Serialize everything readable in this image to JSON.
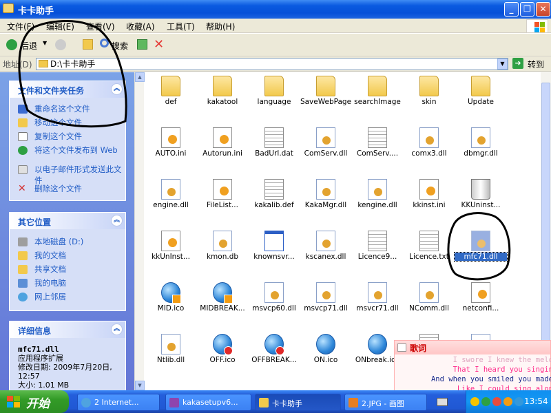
{
  "window": {
    "title": "卡卡助手",
    "min": "_",
    "max": "❐",
    "close": "✕"
  },
  "menu": [
    "文件(F)",
    "编辑(E)",
    "查看(V)",
    "收藏(A)",
    "工具(T)",
    "帮助(H)"
  ],
  "toolbar": {
    "back": "后退",
    "search": "搜索"
  },
  "address": {
    "label": "地址(D)",
    "value": "D:\\卡卡助手",
    "go": "转到"
  },
  "tasks": {
    "header": "文件和文件夹任务",
    "items": [
      "重命名这个文件",
      "移动这个文件",
      "复制这个文件",
      "将这个文件发布到 Web",
      "以电子邮件形式发送此文件",
      "删除这个文件"
    ]
  },
  "places": {
    "header": "其它位置",
    "items": [
      "本地磁盘 (D:)",
      "我的文档",
      "共享文档",
      "我的电脑",
      "网上邻居"
    ]
  },
  "details": {
    "header": "详细信息",
    "name": "mfc71.dll",
    "type": "应用程序扩展",
    "modified": "修改日期: 2009年7月20日, 12:57",
    "size": "大小: 1.01 MB"
  },
  "files": [
    {
      "name": "def",
      "kind": "folder"
    },
    {
      "name": "kakatool",
      "kind": "folder"
    },
    {
      "name": "language",
      "kind": "folder"
    },
    {
      "name": "SaveWebPage",
      "kind": "folder"
    },
    {
      "name": "searchImage",
      "kind": "folder"
    },
    {
      "name": "skin",
      "kind": "folder"
    },
    {
      "name": "Update",
      "kind": "folder"
    },
    {
      "name": "AUTO.ini",
      "kind": "ini"
    },
    {
      "name": "Autorun.ini",
      "kind": "ini"
    },
    {
      "name": "BadUrl.dat",
      "kind": "doc"
    },
    {
      "name": "ComServ.dll",
      "kind": "dll"
    },
    {
      "name": "ComServ....",
      "kind": "doc"
    },
    {
      "name": "comx3.dll",
      "kind": "dll"
    },
    {
      "name": "dbmgr.dll",
      "kind": "dll"
    },
    {
      "name": "engine.dll",
      "kind": "dll"
    },
    {
      "name": "FileList...",
      "kind": "ini"
    },
    {
      "name": "kakalib.def",
      "kind": "doc"
    },
    {
      "name": "KakaMgr.dll",
      "kind": "dll"
    },
    {
      "name": "kengine.dll",
      "kind": "dll"
    },
    {
      "name": "kkinst.ini",
      "kind": "ini"
    },
    {
      "name": "KKUninst...",
      "kind": "trash"
    },
    {
      "name": "kkUnInst...",
      "kind": "ini"
    },
    {
      "name": "kmon.db",
      "kind": "dll"
    },
    {
      "name": "knownsvr...",
      "kind": "win"
    },
    {
      "name": "kscanex.dll",
      "kind": "dll"
    },
    {
      "name": "Licence9...",
      "kind": "doc"
    },
    {
      "name": "Licence.txt",
      "kind": "doc"
    },
    {
      "name": "mfc71.dll",
      "kind": "dll",
      "selected": true
    },
    {
      "name": "MID.ico",
      "kind": "globe-pause"
    },
    {
      "name": "MIDBREAK...",
      "kind": "globe-pause"
    },
    {
      "name": "msvcp60.dll",
      "kind": "dll"
    },
    {
      "name": "msvcp71.dll",
      "kind": "dll"
    },
    {
      "name": "msvcr71.dll",
      "kind": "dll"
    },
    {
      "name": "NComm.dll",
      "kind": "dll"
    },
    {
      "name": "netconfi...",
      "kind": "ini"
    },
    {
      "name": "Ntlib.dll",
      "kind": "dll"
    },
    {
      "name": "OFF.ico",
      "kind": "globe-stop"
    },
    {
      "name": "OFFBREAK...",
      "kind": "globe-stop"
    },
    {
      "name": "ON.ico",
      "kind": "globe"
    },
    {
      "name": "ONbreak.ico",
      "kind": "globe"
    },
    {
      "name": "",
      "kind": "doc"
    },
    {
      "name": "",
      "kind": "dll"
    }
  ],
  "lyrics": {
    "title": "歌词",
    "lines": [
      "I swore I knew the melo",
      "That I heard you singin",
      "And when you smiled you made",
      "Like I could sing alon"
    ]
  },
  "taskbar": {
    "start": "开始",
    "tasks": [
      "2 Internet...",
      "kakasetupv6...",
      "卡卡助手",
      "2.JPG - 画图"
    ],
    "clock": "13:54"
  }
}
